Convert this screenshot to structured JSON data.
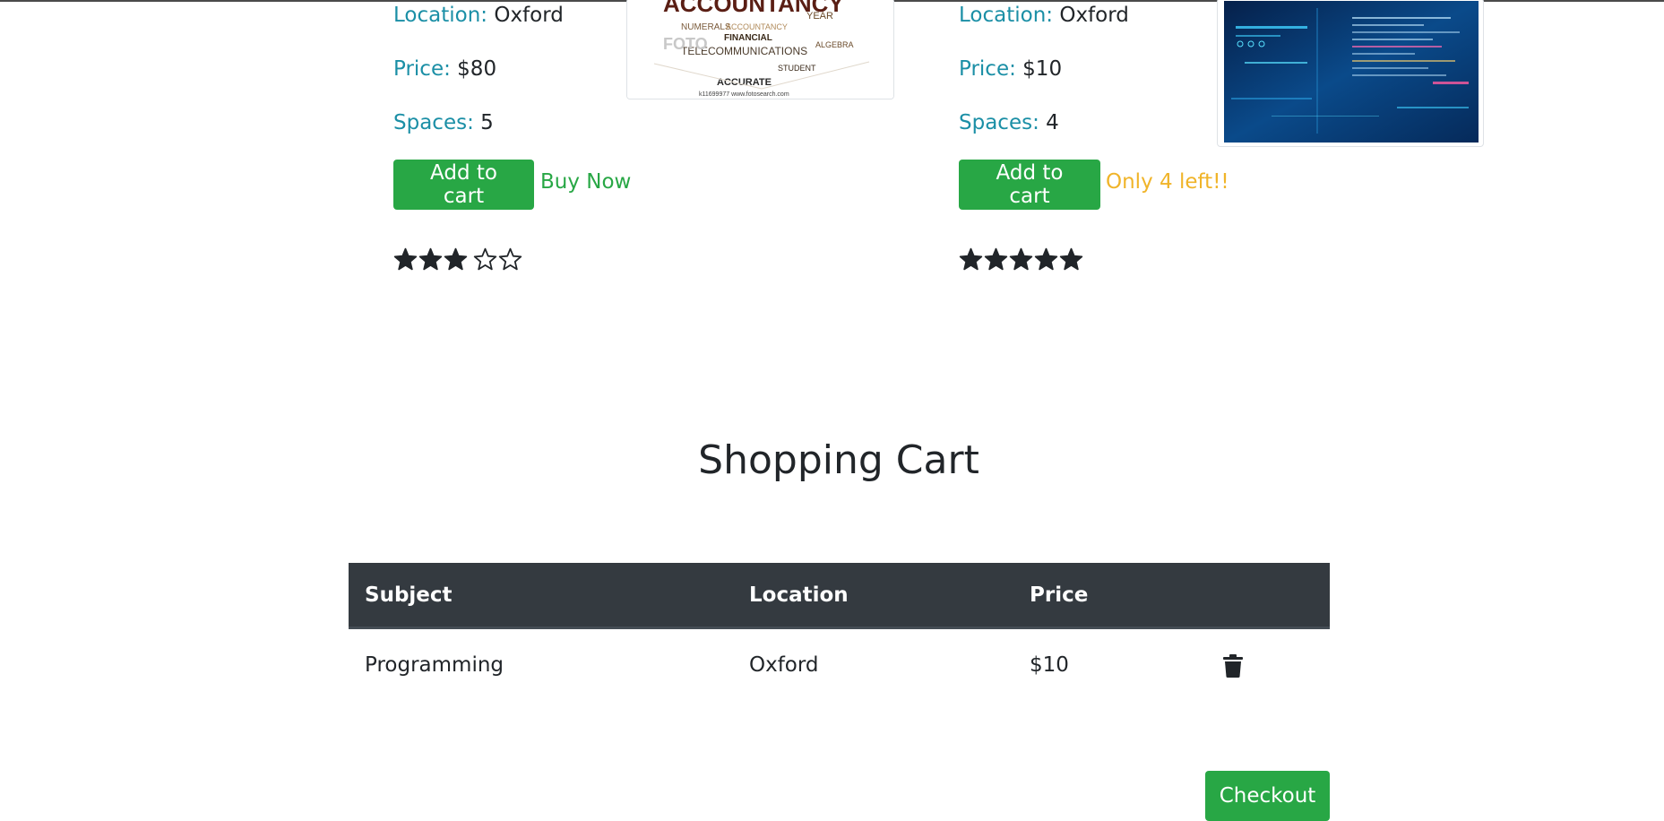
{
  "labels": {
    "location": "Location:",
    "price": "Price:",
    "spaces": "Spaces:"
  },
  "lessons": [
    {
      "location": "Oxford",
      "price": "$80",
      "spaces": "5",
      "add_to_cart": "Add to cart",
      "status": "Buy Now",
      "rating": 3,
      "image": {
        "words": [
          "ACCOUNTANCY",
          "NUMERALS",
          "ACCOUNTANCY",
          "FINANCIAL",
          "YEAR",
          "TELECOMMUNICATIONS",
          "ACCURATE",
          "STUDENT",
          "ALGEBRA",
          "FOTO",
          "k11699977  www.fotosearch.com"
        ]
      }
    },
    {
      "location": "Oxford",
      "price": "$10",
      "spaces": "4",
      "add_to_cart": "Add to cart",
      "status": "Only 4 left!!",
      "rating": 5
    }
  ],
  "cart": {
    "title": "Shopping Cart",
    "headers": [
      "Subject",
      "Location",
      "Price"
    ],
    "rows": [
      {
        "subject": "Programming",
        "location": "Oxford",
        "price": "$10"
      }
    ],
    "checkout_label": "Checkout"
  },
  "colors": {
    "accent_green": "#28a745",
    "label_teal": "#1b8fa6",
    "warning_amber": "#f0b429",
    "table_header": "#343a40"
  }
}
